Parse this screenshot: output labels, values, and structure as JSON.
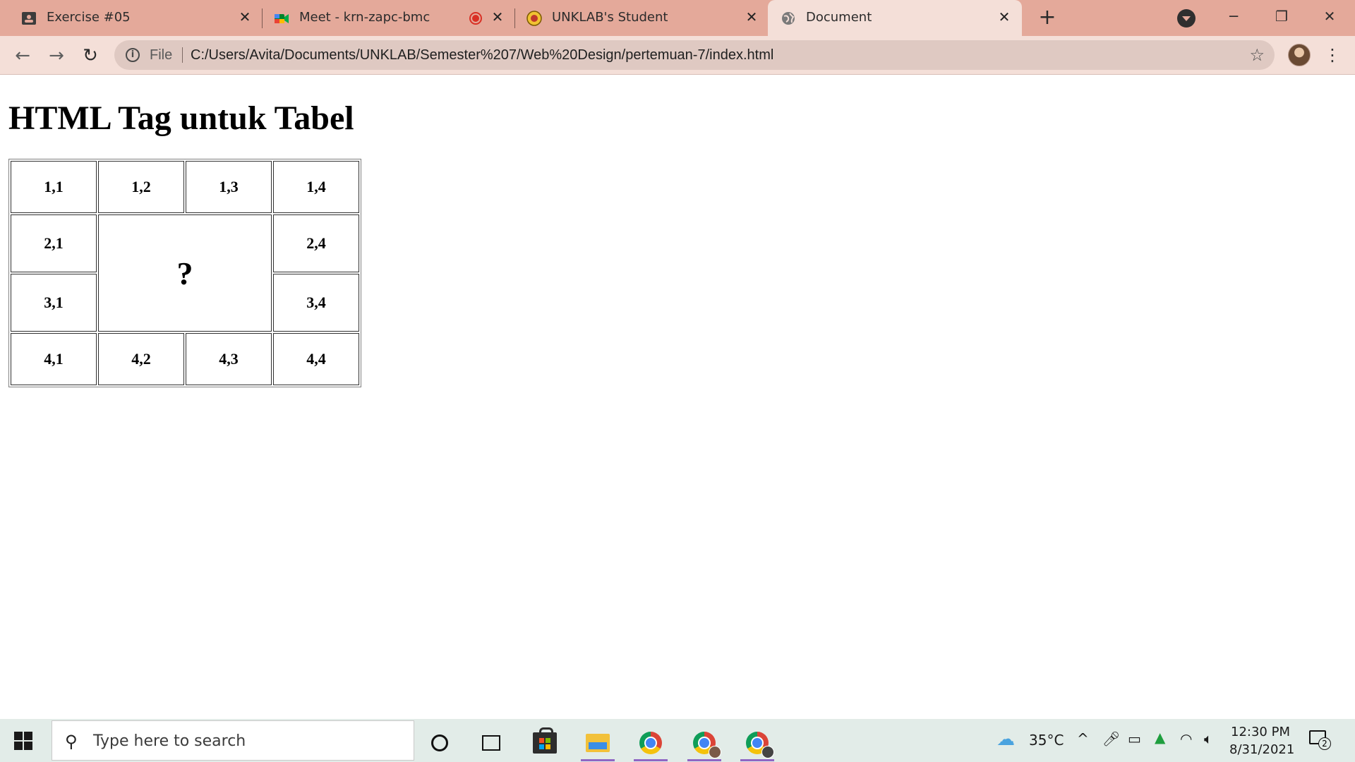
{
  "browser": {
    "tabs": [
      {
        "title": "Exercise #05",
        "icon": "classroom-icon",
        "active": false
      },
      {
        "title": "Meet - krn-zapc-bmc",
        "icon": "google-meet-icon",
        "recording": true,
        "active": false
      },
      {
        "title": "UNKLAB's Student",
        "icon": "unklab-logo-icon",
        "active": false
      },
      {
        "title": "Document",
        "icon": "globe-icon",
        "active": true
      }
    ],
    "new_tab_label": "+",
    "address": {
      "scheme_label": "File",
      "url": "C:/Users/Avita/Documents/UNKLAB/Semester%207/Web%20Design/pertemuan-7/index.html"
    },
    "colors": {
      "tab_strip": "#e4a99a",
      "toolbar": "#f4dfd8",
      "omnibox": "#dfc9c2"
    }
  },
  "page": {
    "heading": "HTML Tag untuk Tabel",
    "table": {
      "row1": [
        "1,1",
        "1,2",
        "1,3",
        "1,4"
      ],
      "row2": {
        "left": "2,1",
        "center": "?",
        "right": "2,4"
      },
      "row3": {
        "left": "3,1",
        "right": "3,4"
      },
      "row4": [
        "4,1",
        "4,2",
        "4,3",
        "4,4"
      ]
    }
  },
  "taskbar": {
    "search_placeholder": "Type here to search",
    "weather": {
      "temperature": "35°C"
    },
    "clock": {
      "time": "12:30 PM",
      "date": "8/31/2021"
    },
    "notification_count": "2",
    "accent_color": "#8e66c4"
  }
}
